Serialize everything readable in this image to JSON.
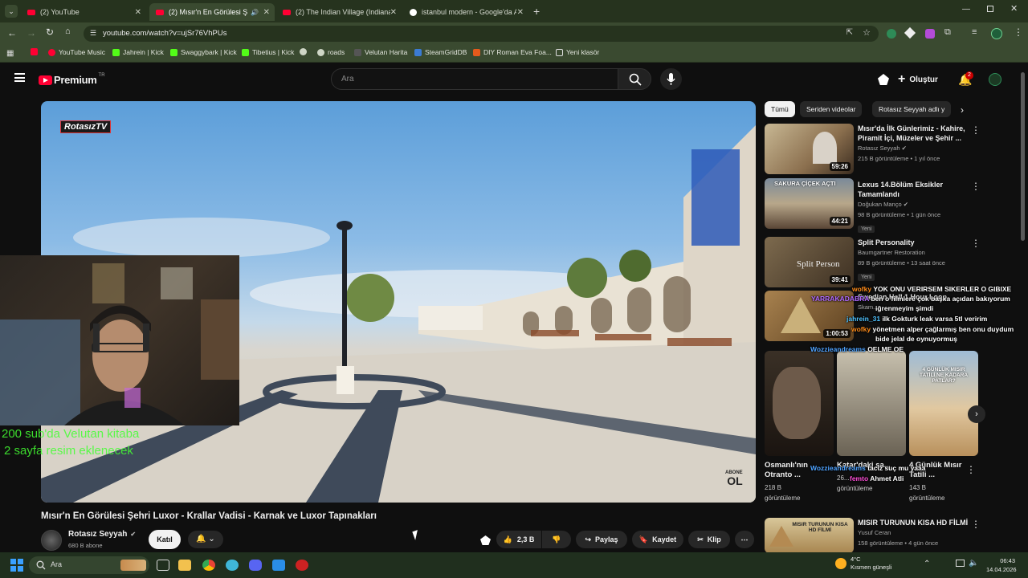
{
  "tabs": [
    {
      "label": "(2) YouTube"
    },
    {
      "label": "(2) Mısır'n En Görülesi Şehri"
    },
    {
      "label": "(2) The Indian Village (Indiana"
    },
    {
      "label": "istanbul modern - Google'da A"
    }
  ],
  "address": {
    "url": "youtube.com/watch?v=ujSr76VhPUs"
  },
  "bookmarks": [
    "YouTube Music",
    "Jahrein | Kick",
    "Swaggybark | Kick",
    "Tibetius | Kick",
    "roads",
    "Velutan Harita",
    "SteamGridDB",
    "DIY Roman Eva Foa...",
    "Yeni klasör"
  ],
  "yt": {
    "logo": "Premium",
    "logo_sup": "TR",
    "search_placeholder": "Ara",
    "create_label": "Oluştur",
    "notif_count": "2"
  },
  "video": {
    "watermark": "RotasızTV",
    "abone_top": "ABONE",
    "abone_bottom": "OL",
    "title": "Mısır'n En Görülesi Şehri Luxor - Krallar Vadisi - Karnak ve Luxor Tapınakları",
    "channel": "Rotasız Seyyah",
    "subs": "680 B abone",
    "join_label": "Katıl",
    "likes": "2,3 B",
    "share_label": "Paylaş",
    "save_label": "Kaydet",
    "clip_label": "Klip",
    "overlay_line1": "200 sub'da Velutan kitaba",
    "overlay_line2": "2 sayfa resim eklenecek"
  },
  "chips": [
    "Tümü",
    "Seriden videolar",
    "Rotasız Seyyah adlı y"
  ],
  "recs": [
    {
      "title": "Mısır'da İlk Günlerimiz - Kahire, Piramit İçi, Müzeler ve Şehir ...",
      "channel": "Rotasız Seyyah",
      "meta": "215 B görüntüleme • 1 yıl önce",
      "duration": "59:26",
      "badge": ""
    },
    {
      "title": "Lexus 14.Bölüm Eksikler Tamamlandı",
      "channel": "Doğukan Manço",
      "meta": "98 B görüntüleme • 1 gün önce",
      "duration": "44:21",
      "badge": "Yeni"
    },
    {
      "title": "Split Personality",
      "channel": "Baumgartner Restoration",
      "meta": "89 B görüntüleme • 13 saat önce",
      "duration": "39:41",
      "badge": "Yeni"
    },
    {
      "title": "Swedian Hall 1 Hour Loop",
      "channel": "Skam...",
      "meta": "",
      "duration": "1:00:53",
      "badge": ""
    }
  ],
  "thumb_text": {
    "sakura": "SAKURA ÇİÇEK AÇTI",
    "split": "Split Person",
    "gunluk": "4 GÜNLÜK MISIR TATİLİ NE KADARA PATLAR?",
    "mısır_thumb": "MISIR TURUNUN KISA HD FİLMİ"
  },
  "shorts": [
    {
      "title": "Osmanlı'nın Otranto ...",
      "views": "218 B",
      "unit": "görüntüleme"
    },
    {
      "title": "Katar'daki şa...",
      "views": "26...",
      "unit": "görüntüleme"
    },
    {
      "title": "4 Günlük Mısır Tatili ...",
      "views": "143 B",
      "unit": "görüntüleme"
    }
  ],
  "last_rec": {
    "title": "MISIR TURUNUN KISA HD FİLMİ",
    "channel": "Yusuf Ceran",
    "meta": "158 görüntüleme • 4 gün önce"
  },
  "chat": [
    {
      "user": "wofky",
      "msg": "YOK ONU VERIRSEM SIKERLER O GIBIXE",
      "color": "#ff8c1a"
    },
    {
      "user": "YARRAKADABRA",
      "msg": "ben o filmlere çok başka açıdan bakıyorum",
      "color": "#b06bff"
    },
    {
      "user": "",
      "msg": "iğrenmeyim şimdi",
      "color": ""
    },
    {
      "user": "jahrein_31",
      "msg": "ilk Gokturk leak varsa 5tl veririm",
      "color": "#4fc3ff"
    },
    {
      "user": "wofky",
      "msg": "yönetmen alper çağlarmış ben onu duydum",
      "color": "#ff8c1a"
    },
    {
      "user": "",
      "msg": "bide jelal de oynuyormuş",
      "color": ""
    },
    {
      "user": "Wozzieandreams",
      "msg": "OELME OE",
      "color": "#4fa3ff"
    },
    {
      "user": "Wozzieandreams",
      "msg": "taciz suç mu yaaa",
      "color": "#4fa3ff"
    },
    {
      "user": "femto",
      "msg": "Ahmet Atli",
      "color": "#ff4fd8"
    }
  ],
  "taskbar": {
    "search": "Ara",
    "weather_temp": "4°C",
    "weather_desc": "Kısmen güneşli",
    "time": "06:43",
    "date": "14.04.2026"
  }
}
